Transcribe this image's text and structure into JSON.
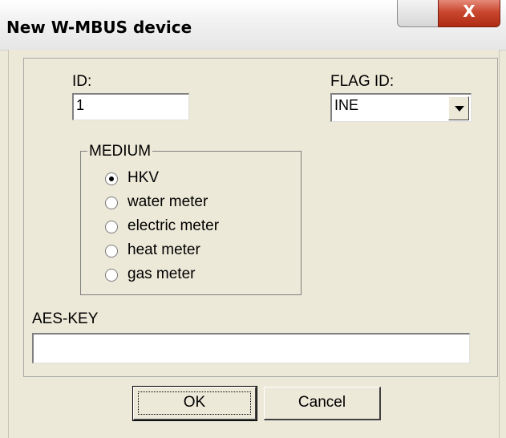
{
  "window": {
    "title": "New W-MBUS device",
    "close_glyph": "X",
    "icons": {
      "minimize": "minimize-icon",
      "close": "close-icon"
    }
  },
  "form": {
    "id_label": "ID:",
    "id_value": "1",
    "flag_label": "FLAG ID:",
    "flag_value": "INE",
    "medium": {
      "title": "MEDIUM",
      "options": [
        {
          "label": "HKV",
          "checked": true
        },
        {
          "label": "water meter",
          "checked": false
        },
        {
          "label": "electric meter",
          "checked": false
        },
        {
          "label": "heat meter",
          "checked": false
        },
        {
          "label": "gas meter",
          "checked": false
        }
      ]
    },
    "aes_label": "AES-KEY",
    "aes_value": ""
  },
  "buttons": {
    "ok": "OK",
    "cancel": "Cancel"
  },
  "colors": {
    "face": "#ece9d8",
    "close_button": "#c9472f"
  }
}
